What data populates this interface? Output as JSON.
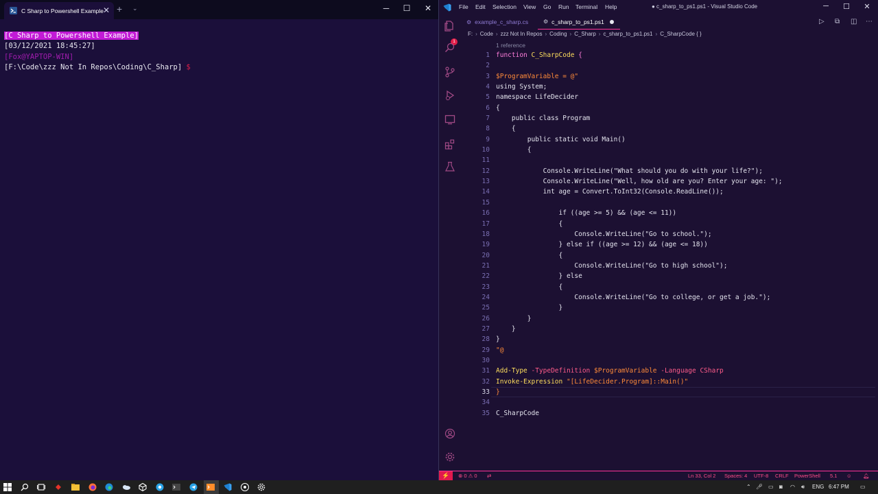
{
  "terminal": {
    "tab_title": "C Sharp to Powershell Example",
    "new_tab": "+",
    "dropdown": "⌄",
    "close": "✕",
    "lines": {
      "header": "[C Sharp to Powershell Example]",
      "timestamp": "[03/12/2021 18:45:27]",
      "user": "[Fox@YAPTOP-WIN]",
      "path": "[F:\\Code\\zzz Not In Repos\\Coding\\C_Sharp]",
      "prompt": "$"
    }
  },
  "window_controls": {
    "minimize": "─",
    "maximize": "☐",
    "close": "✕"
  },
  "vscode": {
    "menu": [
      "File",
      "Edit",
      "Selection",
      "View",
      "Go",
      "Run",
      "Terminal",
      "Help"
    ],
    "title": "● c_sharp_to_ps1.ps1 - Visual Studio Code",
    "activity_badge": "1",
    "tabs": [
      {
        "label": "example_c_sharp.cs"
      },
      {
        "label": "c_sharp_to_ps1.ps1"
      }
    ],
    "breadcrumb": [
      "F:",
      "Code",
      "zzz Not In Repos",
      "Coding",
      "C_Sharp",
      "c_sharp_to_ps1.ps1",
      "C_SharpCode { }"
    ],
    "codelens": "1 reference",
    "line_numbers": [
      "1",
      "2",
      "3",
      "4",
      "5",
      "6",
      "7",
      "8",
      "9",
      "10",
      "11",
      "12",
      "13",
      "14",
      "15",
      "16",
      "17",
      "18",
      "19",
      "20",
      "21",
      "22",
      "23",
      "24",
      "25",
      "26",
      "27",
      "28",
      "29",
      "30",
      "31",
      "32",
      "33",
      "34",
      "35"
    ],
    "code": {
      "l1a": "function",
      "l1b": "C_SharpCode",
      "l1c": "{",
      "l3a": "$ProgramVariable",
      "l3b": " = @\"",
      "l4": "using System;",
      "l5": "namespace LifeDecider",
      "l6": "{",
      "l7": "    public class Program",
      "l8": "    {",
      "l9": "        public static void Main()",
      "l10": "        {",
      "l12": "            Console.WriteLine(\"What should you do with your life?\");",
      "l13": "            Console.WriteLine(\"Well, how old are you? Enter your age: \");",
      "l14": "            int age = Convert.ToInt32(Console.ReadLine());",
      "l16": "                if ((age >= 5) && (age <= 11))",
      "l17": "                {",
      "l18": "                    Console.WriteLine(\"Go to school.\");",
      "l19": "                } else if ((age >= 12) && (age <= 18))",
      "l20": "                {",
      "l21": "                    Console.WriteLine(\"Go to high school\");",
      "l22": "                } else",
      "l23": "                {",
      "l24": "                    Console.WriteLine(\"Go to college, or get a job.\");",
      "l25": "                }",
      "l26": "        }",
      "l27": "    }",
      "l28": "}",
      "l29": "\"@",
      "l31a": "Add-Type",
      "l31b": " -TypeDefinition",
      "l31c": " $ProgramVariable",
      "l31d": " -Language",
      "l31e": " CSharp",
      "l32a": "Invoke-Expression",
      "l32b": " \"[LifeDecider.Program]::Main()\"",
      "l33": "}",
      "l35": "C_SharpCode"
    },
    "status": {
      "problems": "⊗ 0 ⚠ 0",
      "position": "Ln 33, Col 2",
      "spaces": "Spaces: 4",
      "encoding": "UTF-8",
      "eol": "CRLF",
      "language": "PowerShell",
      "version": "5.1"
    }
  },
  "taskbar": {
    "language": "ENG",
    "time": "6:47 PM"
  },
  "colors": {
    "accent": "#ff3399",
    "highlight": "#c21ad6",
    "keyword": "#ff7edb",
    "function": "#fede5d",
    "variable": "#ff8b39"
  }
}
